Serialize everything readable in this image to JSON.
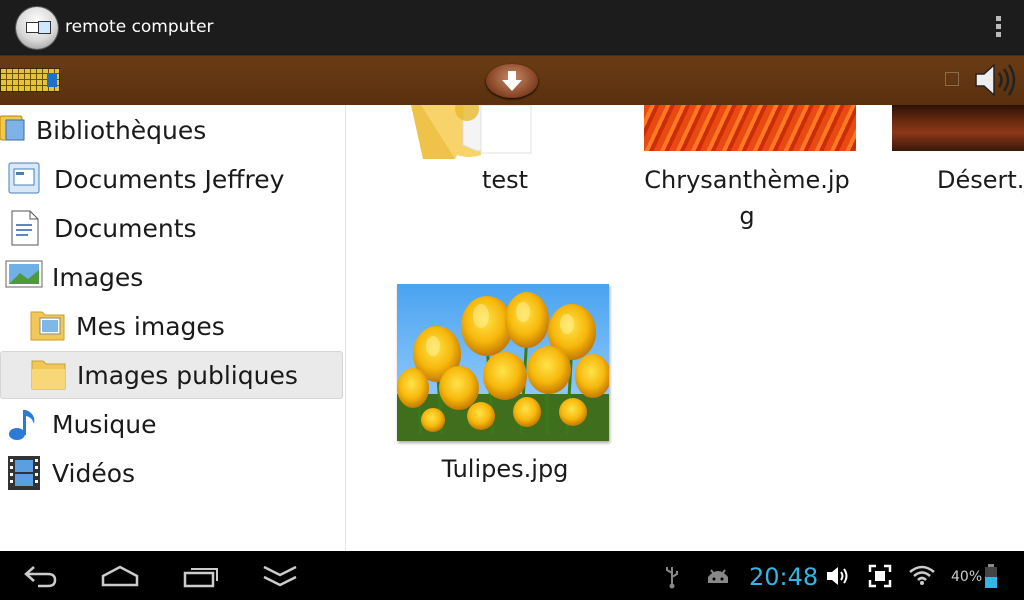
{
  "app": {
    "title": "remote computer"
  },
  "sidebar": {
    "items": [
      {
        "label": "Bibliothèques",
        "icon": "library-icon"
      },
      {
        "label": "Documents Jeffrey",
        "icon": "document-folder-icon"
      },
      {
        "label": "Documents",
        "icon": "document-icon"
      },
      {
        "label": "Images",
        "icon": "images-icon"
      },
      {
        "label": "Mes images",
        "icon": "folder-icon"
      },
      {
        "label": "Images publiques",
        "icon": "folder-icon",
        "selected": true
      },
      {
        "label": "Musique",
        "icon": "music-note-icon"
      },
      {
        "label": "Vidéos",
        "icon": "film-icon"
      }
    ]
  },
  "files": [
    {
      "label": "test",
      "type": "folder"
    },
    {
      "label_line1": "Chrysanthème.jp",
      "label_line2": "g",
      "type": "image"
    },
    {
      "label": "Désert.j",
      "type": "image"
    },
    {
      "label": "Tulipes.jpg",
      "type": "image"
    }
  ],
  "statusbar": {
    "time": "20:48",
    "battery": "40%"
  },
  "colors": {
    "toolbar": "#5f3410",
    "clock": "#33b5e5"
  }
}
